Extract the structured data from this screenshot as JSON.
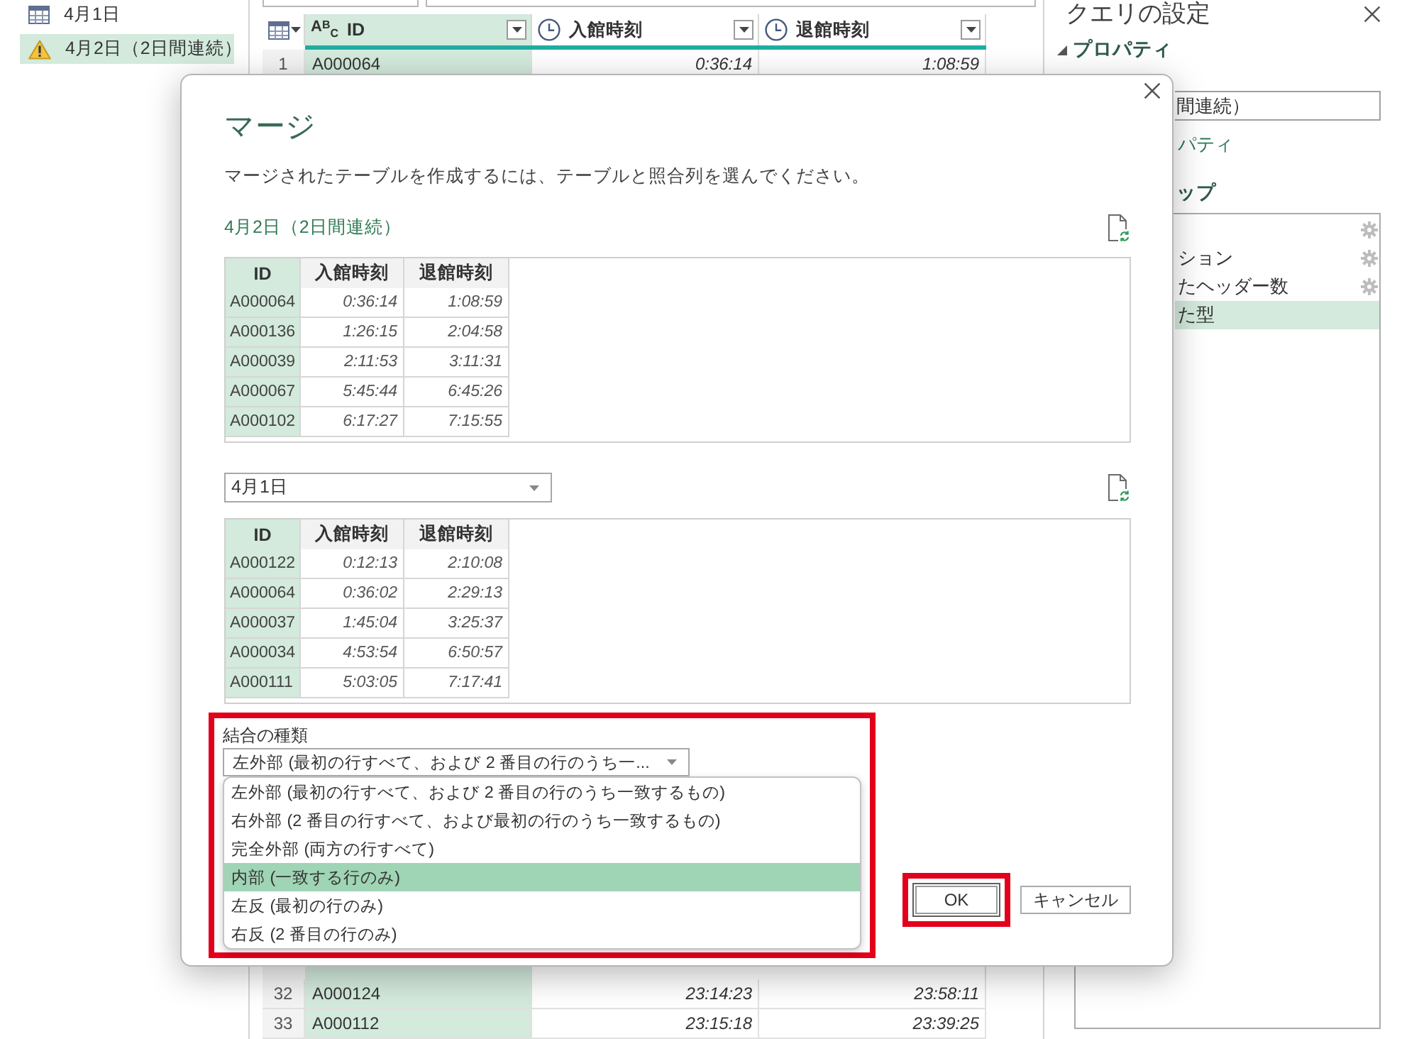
{
  "query_list": [
    {
      "kind": "table",
      "label": "4月1日",
      "selected": false
    },
    {
      "kind": "warning",
      "label": "4月2日（2日間連続）",
      "selected": true
    }
  ],
  "data_grid": {
    "columns": [
      {
        "name": "ID",
        "kind": "text",
        "type_label": "A$^{B}$$_{C}$",
        "selected": true
      },
      {
        "name": "入館時刻",
        "kind": "time",
        "selected": false
      },
      {
        "name": "退館時刻",
        "kind": "time",
        "selected": false
      }
    ],
    "top_rows": [
      {
        "number": "1",
        "cells": [
          "A000064",
          "0:36:14",
          "1:08:59"
        ]
      }
    ],
    "bottom_rows": [
      {
        "number": "32",
        "cells": [
          "A000124",
          "23:14:23",
          "23:58:11"
        ]
      },
      {
        "number": "33",
        "cells": [
          "A000112",
          "23:15:18",
          "23:39:25"
        ]
      }
    ]
  },
  "query_settings": {
    "title": "クエリの設定",
    "properties": {
      "title": "プロパティ",
      "expanded": true,
      "name": "間連続）",
      "all_properties_link": "パティ"
    },
    "applied_steps": {
      "title": "ップ",
      "steps": [
        {
          "has_settings": true,
          "selected": false
        },
        {
          "label": "ション",
          "has_settings": true,
          "selected": false
        },
        {
          "label": "たヘッダー数",
          "has_settings": true,
          "selected": false
        },
        {
          "label": "た型",
          "has_settings": false,
          "selected": true
        }
      ]
    }
  },
  "merge_dialog": {
    "title": "マージ",
    "description": "マージされたテーブルを作成するには、テーブルと照合列を選んでください。",
    "first_table": {
      "name": "4月2日（2日間連続）",
      "columns": [
        {
          "name": "ID",
          "kind": "text",
          "selected": true
        },
        {
          "name": "入館時刻",
          "kind": "time",
          "selected": false
        },
        {
          "name": "退館時刻",
          "kind": "time",
          "selected": false
        }
      ],
      "rows": [
        [
          "A000064",
          "0:36:14",
          "1:08:59"
        ],
        [
          "A000136",
          "1:26:15",
          "2:04:58"
        ],
        [
          "A000039",
          "2:11:53",
          "3:11:31"
        ],
        [
          "A000067",
          "5:45:44",
          "6:45:26"
        ],
        [
          "A000102",
          "6:17:27",
          "7:15:55"
        ]
      ]
    },
    "second_table": {
      "selected_table": "4月1日",
      "columns": [
        {
          "name": "ID",
          "kind": "text",
          "selected": true
        },
        {
          "name": "入館時刻",
          "kind": "time",
          "selected": false
        },
        {
          "name": "退館時刻",
          "kind": "time",
          "selected": false
        }
      ],
      "rows": [
        [
          "A000122",
          "0:12:13",
          "2:10:08"
        ],
        [
          "A000064",
          "0:36:02",
          "2:29:13"
        ],
        [
          "A000037",
          "1:45:04",
          "3:25:37"
        ],
        [
          "A000034",
          "4:53:54",
          "6:50:57"
        ],
        [
          "A000111",
          "5:03:05",
          "7:17:41"
        ]
      ]
    },
    "join_kind": {
      "label": "結合の種類",
      "value": "左外部 (最初の行すべて、および 2 番目の行のうち一...",
      "expanded": true,
      "highlighted": true,
      "options": [
        {
          "label": "左外部 (最初の行すべて、および 2 番目の行のうち一致するもの)",
          "selected": false
        },
        {
          "label": "右外部 (2 番目の行すべて、および最初の行のうち一致するもの)",
          "selected": false
        },
        {
          "label": "完全外部 (両方の行すべて)",
          "selected": false
        },
        {
          "label": "内部 (一致する行のみ)",
          "selected": true
        },
        {
          "label": "左反 (最初の行のみ)",
          "selected": false
        },
        {
          "label": "右反 (2 番目の行のみ)",
          "selected": false
        }
      ]
    },
    "buttons": [
      {
        "label": "OK",
        "focused": true,
        "highlighted": true
      },
      {
        "label": "キャンセル",
        "focused": false,
        "highlighted": false
      }
    ]
  }
}
